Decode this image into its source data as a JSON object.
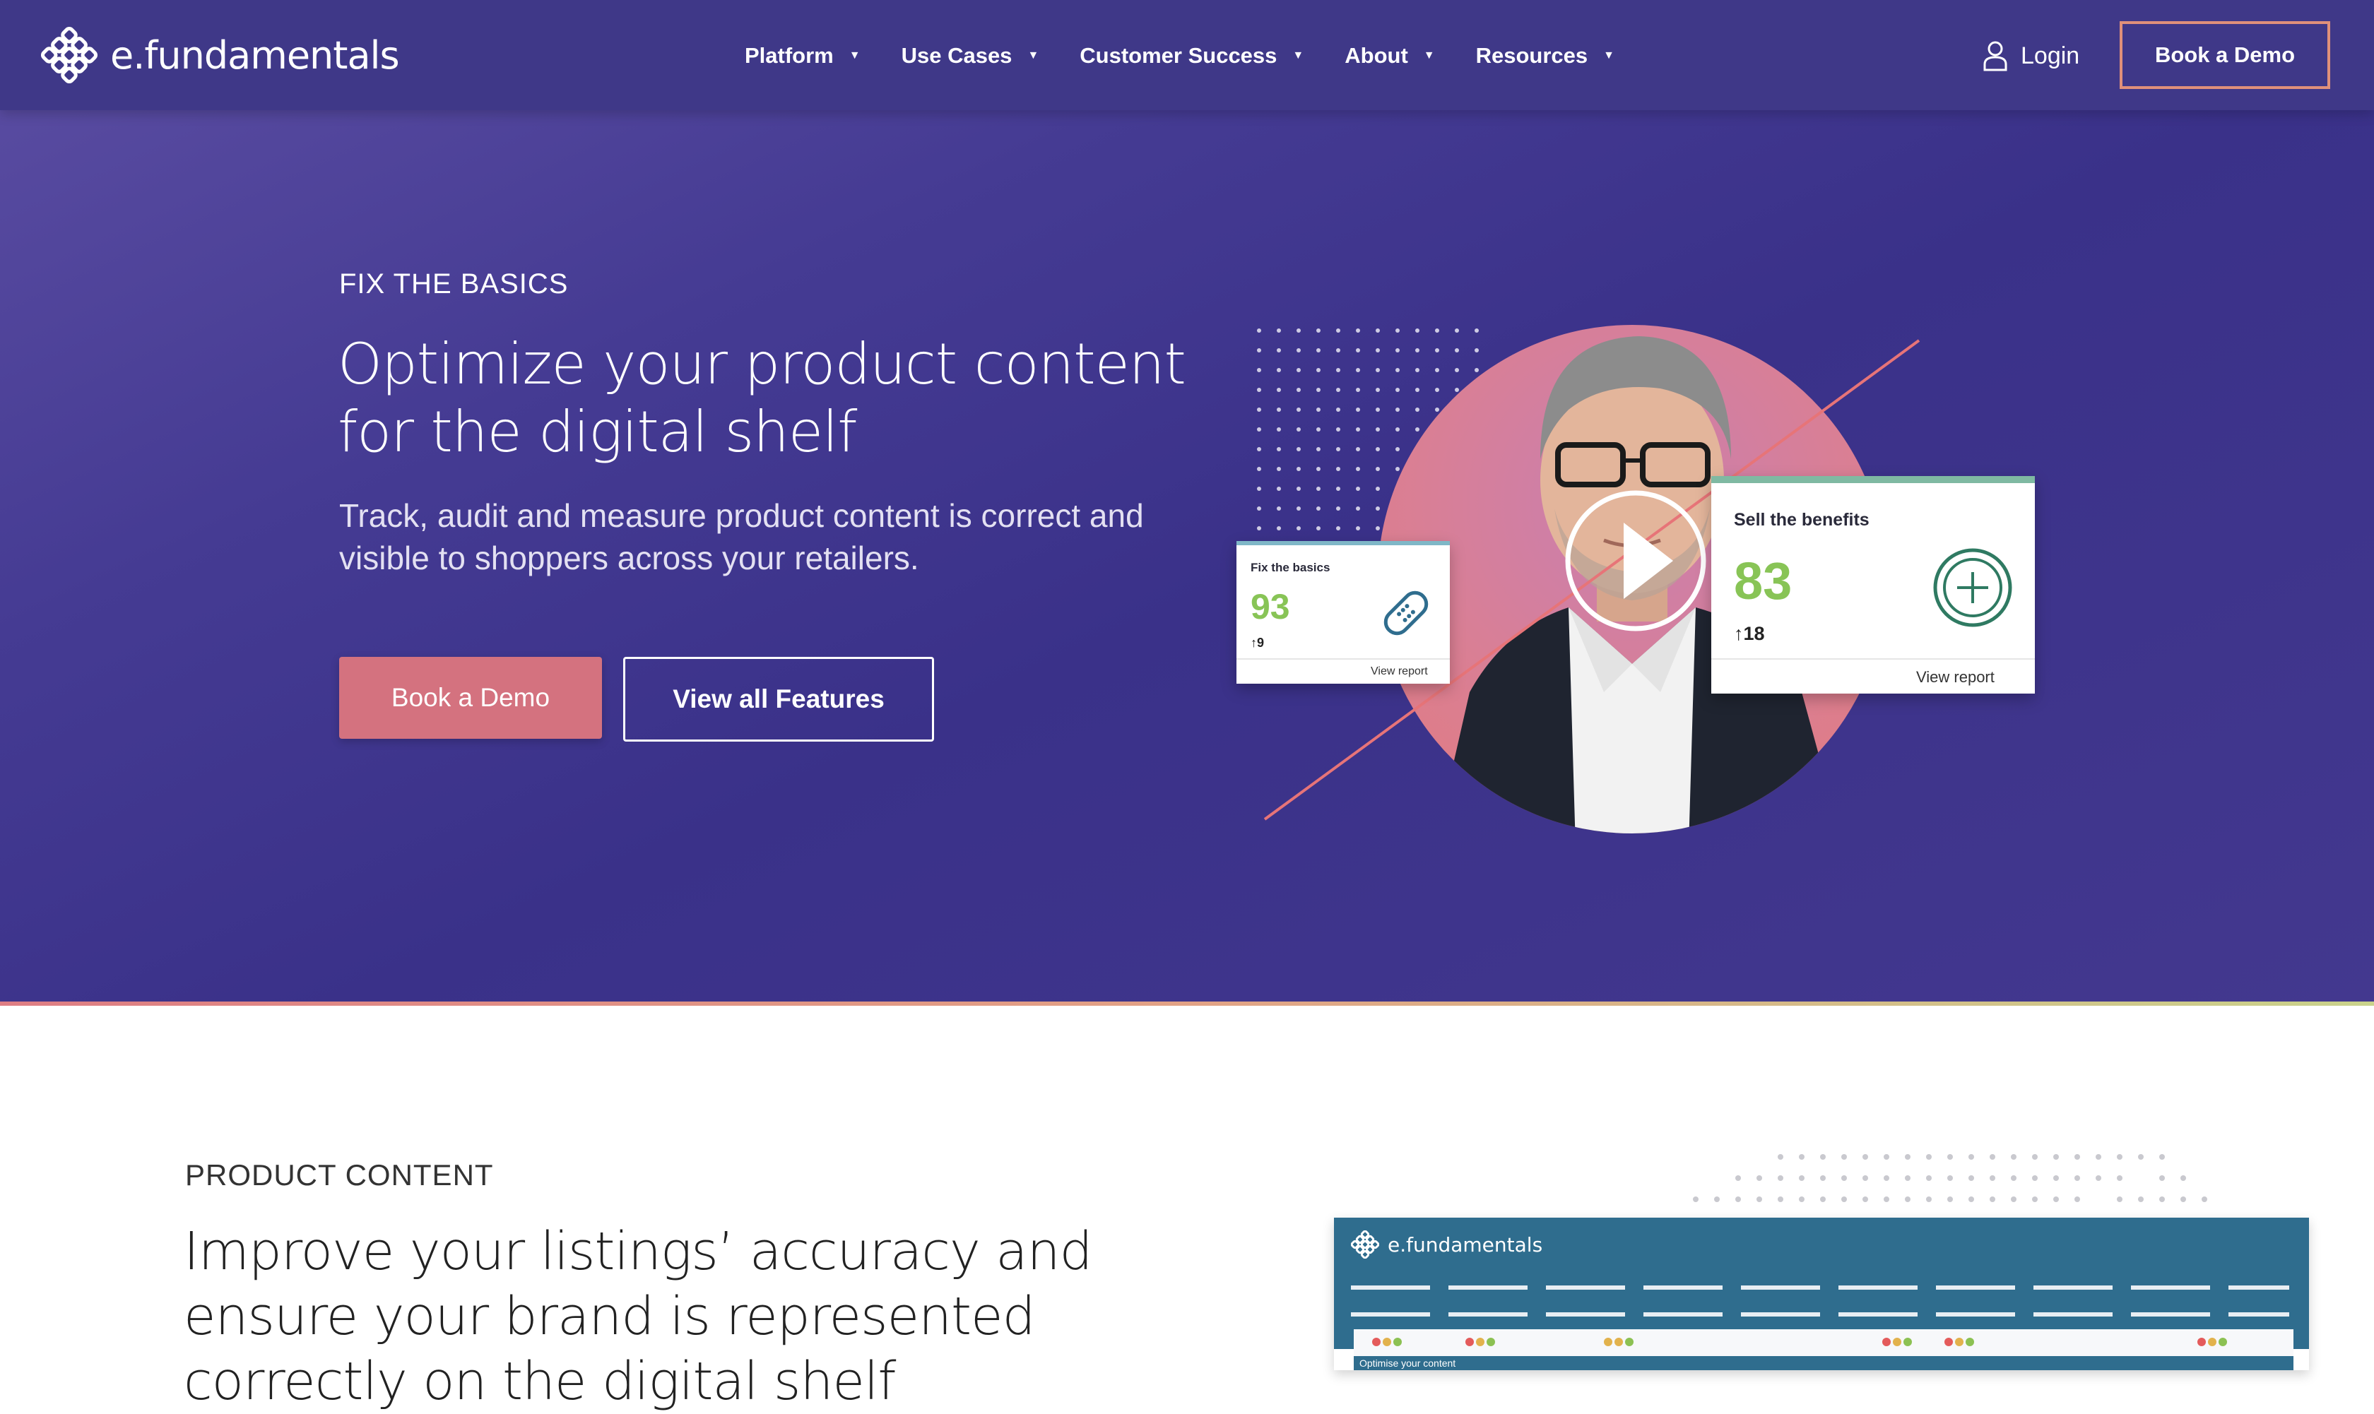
{
  "brand": {
    "name": "e.fundamentals"
  },
  "nav": {
    "items": [
      {
        "label": "Platform"
      },
      {
        "label": "Use Cases"
      },
      {
        "label": "Customer Success"
      },
      {
        "label": "About"
      },
      {
        "label": "Resources"
      }
    ],
    "login_label": "Login",
    "book_demo_label": "Book a Demo"
  },
  "hero": {
    "eyebrow": "FIX THE BASICS",
    "title": "Optimize your product content for the digital shelf",
    "subtitle": "Track, audit and measure product content is correct and visible to shoppers across your retailers.",
    "primary_cta": "Book a Demo",
    "secondary_cta": "View all Features",
    "card_small": {
      "label": "Fix the basics",
      "score": "93",
      "change": "9",
      "link": "View report"
    },
    "card_large": {
      "label": "Sell the benefits",
      "score": "83",
      "change": "18",
      "link": "View report"
    }
  },
  "section2": {
    "eyebrow": "PRODUCT CONTENT",
    "title": "Improve your listings’ accuracy and ensure your brand is represented correctly on the digital shelf",
    "dashboard": {
      "brand": "e.fundamentals",
      "footer": "Optimise your content"
    }
  },
  "colors": {
    "header": "#3f3888",
    "accent_pink": "#d4727f",
    "score_green": "#88c456",
    "dashboard_blue": "#2f6d8e"
  }
}
